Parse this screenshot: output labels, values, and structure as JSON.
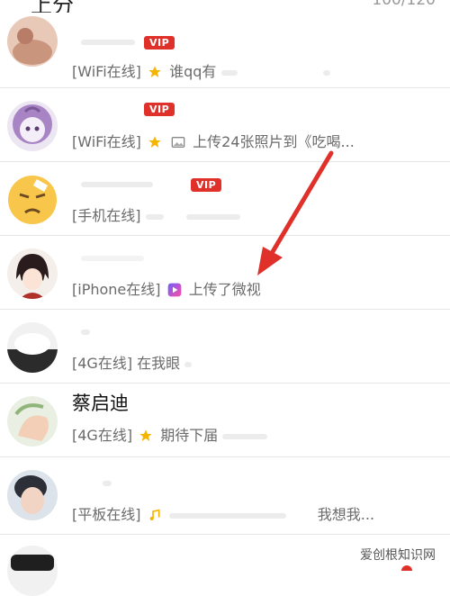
{
  "header": {
    "title": "上分",
    "count": "100/120"
  },
  "vip_label": "VIP",
  "contacts": [
    {
      "name": "",
      "status_tag": "[WiFi在线]",
      "status_text": "谁qq有",
      "icon": "star-icon"
    },
    {
      "name": "",
      "status_tag": "[WiFi在线]",
      "status_text": "上传24张照片到《吃喝...",
      "icon": "star-icon"
    },
    {
      "name": "",
      "status_tag": "[手机在线]",
      "status_text": "",
      "icon": ""
    },
    {
      "name": "",
      "status_tag": "[iPhone在线]",
      "status_text": "上传了微视",
      "icon": "weishi-icon"
    },
    {
      "name": "",
      "status_tag": "[4G在线]",
      "status_text": "在我眼",
      "icon": ""
    },
    {
      "name": "蔡启迪",
      "status_tag": "[4G在线]",
      "status_text": "期待下届",
      "icon": "star-icon"
    },
    {
      "name": "",
      "status_tag": "[平板在线]",
      "status_text": "我想我...",
      "icon": "music-note-icon"
    }
  ],
  "watermark": "爱创根知识网",
  "colors": {
    "vip": "#e0302a",
    "arrow": "#e0302a",
    "star": "#f5b400",
    "divider": "#e6e6e6"
  }
}
